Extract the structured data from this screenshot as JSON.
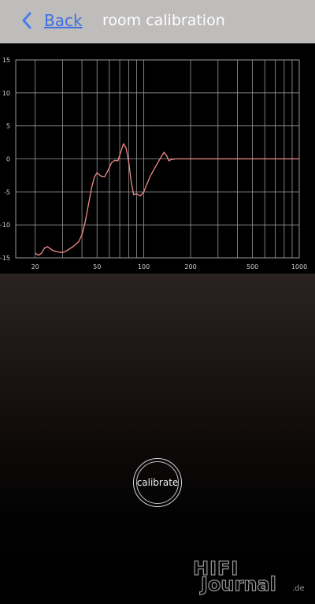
{
  "header": {
    "back_label": "Back",
    "title": "room calibration"
  },
  "icons": {
    "back": "chevron-left-icon"
  },
  "colors": {
    "header_bg": "#bfbcbc",
    "accent": "#3f6fe0",
    "curve": "#f08a8a",
    "grid": "#9a9a9a"
  },
  "chart_data": {
    "type": "line",
    "title": "",
    "xlabel": "",
    "ylabel": "",
    "xscale": "log",
    "xlim": [
      15,
      1000
    ],
    "ylim": [
      -15,
      15
    ],
    "grid": true,
    "y_ticks": [
      15,
      10,
      5,
      0,
      -5,
      -10,
      -15
    ],
    "x_ticks": [
      20,
      50,
      100,
      200,
      500,
      1000
    ],
    "x_gridlines": [
      20,
      30,
      40,
      50,
      60,
      70,
      80,
      90,
      100,
      200,
      300,
      400,
      500,
      600,
      700,
      800,
      900,
      1000
    ],
    "series": [
      {
        "points": [
          [
            20,
            -14.3
          ],
          [
            21,
            -14.6
          ],
          [
            22,
            -14.3
          ],
          [
            23,
            -13.5
          ],
          [
            24,
            -13.3
          ],
          [
            25,
            -13.6
          ],
          [
            26,
            -13.9
          ],
          [
            28,
            -14.1
          ],
          [
            30,
            -14.2
          ],
          [
            32,
            -13.9
          ],
          [
            35,
            -13.3
          ],
          [
            38,
            -12.6
          ],
          [
            40,
            -11.5
          ],
          [
            42,
            -9.5
          ],
          [
            44,
            -7.0
          ],
          [
            46,
            -4.5
          ],
          [
            48,
            -2.8
          ],
          [
            50,
            -2.1
          ],
          [
            53,
            -2.6
          ],
          [
            56,
            -2.7
          ],
          [
            59,
            -1.7
          ],
          [
            62,
            -0.6
          ],
          [
            65,
            -0.2
          ],
          [
            68,
            -0.3
          ],
          [
            71,
            1.0
          ],
          [
            74,
            2.3
          ],
          [
            77,
            1.6
          ],
          [
            80,
            -0.5
          ],
          [
            83,
            -3.5
          ],
          [
            86,
            -5.4
          ],
          [
            90,
            -5.3
          ],
          [
            95,
            -5.6
          ],
          [
            100,
            -5.0
          ],
          [
            110,
            -2.6
          ],
          [
            120,
            -1.0
          ],
          [
            130,
            0.4
          ],
          [
            135,
            1.0
          ],
          [
            140,
            0.5
          ],
          [
            145,
            -0.3
          ],
          [
            150,
            -0.1
          ],
          [
            160,
            0.0
          ],
          [
            200,
            0.0
          ],
          [
            300,
            0.0
          ],
          [
            500,
            0.0
          ],
          [
            1000,
            0.0
          ]
        ]
      }
    ]
  },
  "button": {
    "calibrate_label": "calibrate"
  },
  "watermark": {
    "line1": "HIFI",
    "line2": "Journal",
    "suffix": ".de"
  }
}
